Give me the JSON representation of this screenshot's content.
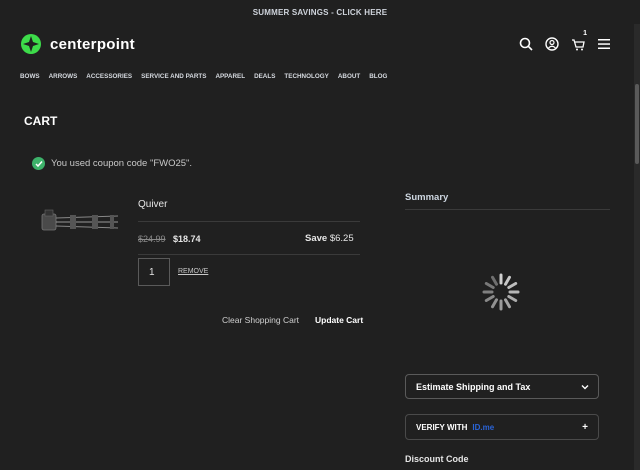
{
  "promo": {
    "text": "SUMMER SAVINGS - CLICK HERE"
  },
  "header": {
    "logo_text": "centerpoint",
    "cart_count": "1",
    "icons": [
      "search-icon",
      "account-icon",
      "cart-icon",
      "menu-icon"
    ]
  },
  "nav": [
    "BOWS",
    "ARROWS",
    "ACCESSORIES",
    "SERVICE AND PARTS",
    "APPAREL",
    "DEALS",
    "TECHNOLOGY",
    "ABOUT",
    "BLOG"
  ],
  "page": {
    "title": "CART"
  },
  "message": {
    "text": "You used coupon code \"FWO25\"."
  },
  "item": {
    "name": "Quiver",
    "old_price": "$24.99",
    "price": "$18.74",
    "save_label": "Save",
    "save_amount": "$6.25",
    "qty": "1",
    "remove": "REMOVE"
  },
  "actions": {
    "clear": "Clear Shopping Cart",
    "update": "Update Cart"
  },
  "summary": {
    "title": "Summary",
    "shipping": "Estimate Shipping and Tax",
    "verify": "VERIFY WITH",
    "verify_brand": "ID.me",
    "plus": "+",
    "discount": "Discount Code"
  },
  "colors": {
    "accent": "#3ddc4a",
    "background": "#202020",
    "success": "#3db26a"
  }
}
